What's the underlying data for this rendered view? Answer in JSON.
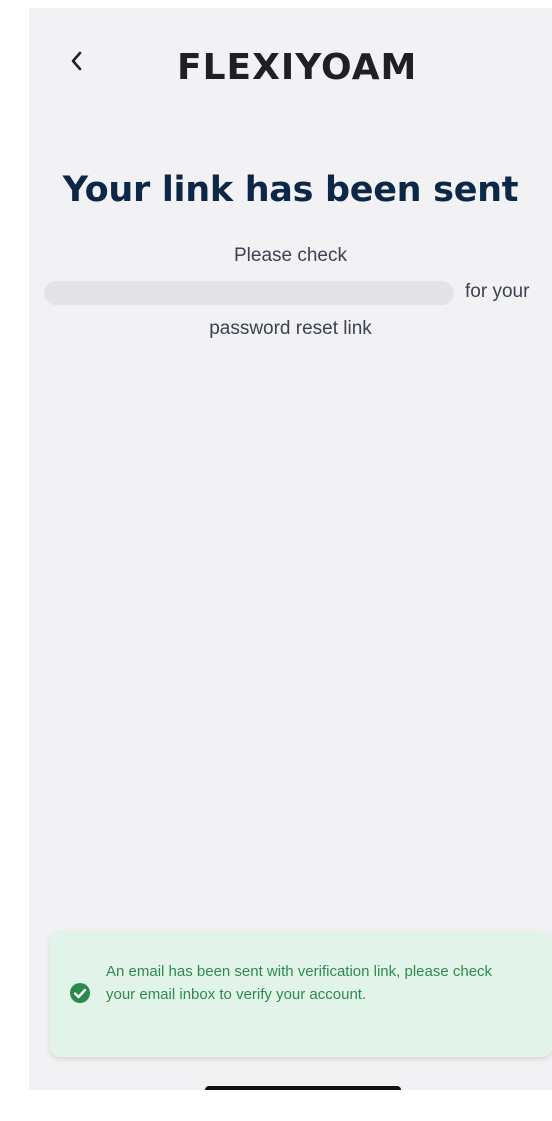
{
  "header": {
    "back_icon": "chevron-left-icon",
    "logo_text": "FLEXIYOAM"
  },
  "main": {
    "title": "Your link has been sent",
    "message_line1": "Please check",
    "message_line2_suffix": "for your",
    "message_line3": "password reset link"
  },
  "toast": {
    "icon": "check-circle-icon",
    "text": "An email has been sent with verification link, please check your email inbox to verify your account."
  },
  "colors": {
    "background": "#f2f2f5",
    "title": "#0c2747",
    "toast_bg": "#e2f4ea",
    "toast_text": "#2d8a4e",
    "success_icon": "#2a8a4c"
  }
}
